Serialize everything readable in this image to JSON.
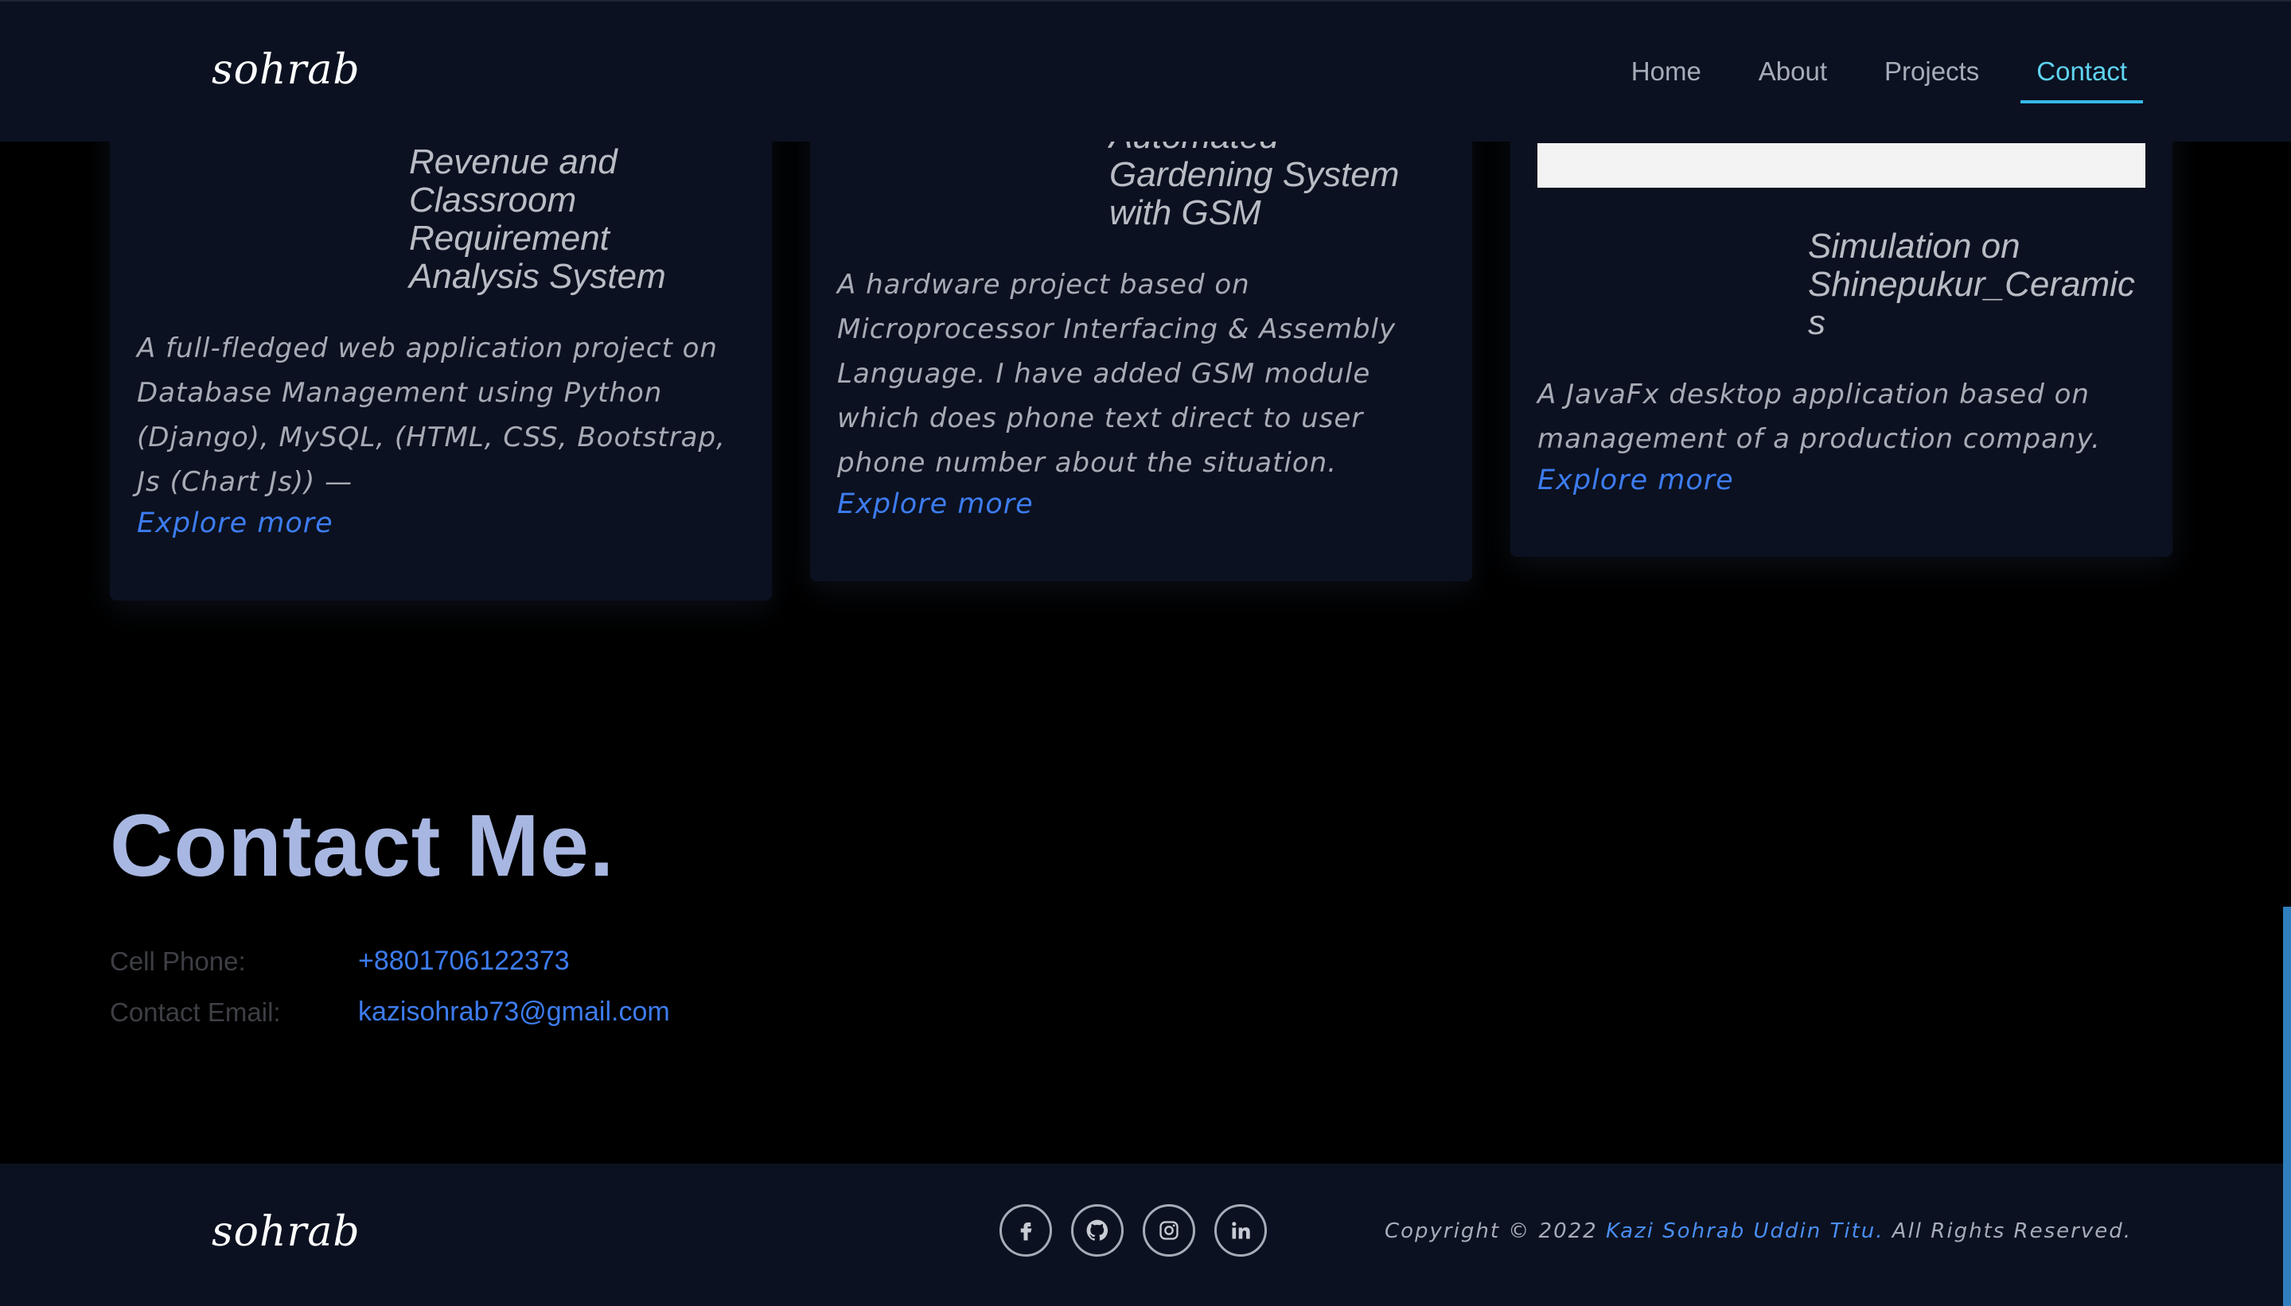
{
  "header": {
    "logo": "sohrab",
    "nav": [
      "Home",
      "About",
      "Projects",
      "Contact"
    ],
    "active_nav": "Contact"
  },
  "projects": [
    {
      "title": "Revenue and\nClassroom\nRequirement\nAnalysis System",
      "description": "A full-fledged web application project on Database Management using Python (Django), MySQL, (HTML, CSS, Bootstrap, Js (Chart Js)) —",
      "link": "Explore more"
    },
    {
      "title": "Automated\nGardening System\nwith GSM",
      "description": "A hardware project based on Microprocessor Interfacing & Assembly Language. I have added GSM module which does phone text direct to user phone number about the situation.",
      "link": "Explore more"
    },
    {
      "title": "Simulation on\nShinepukur_Ceramic\ns",
      "description": "A JavaFx desktop application based on management of a production company.",
      "link": "Explore more"
    }
  ],
  "contact": {
    "heading": "Contact Me.",
    "phone_label": "Cell Phone:",
    "phone": "+8801706122373",
    "email_label": "Contact Email:",
    "email": "kazisohrab73@gmail.com"
  },
  "footer": {
    "logo": "sohrab",
    "social": [
      "facebook-icon",
      "github-icon",
      "instagram-icon",
      "linkedin-icon"
    ],
    "copyright_prefix": "Copyright © 2022 ",
    "copyright_name": "Kazi Sohrab Uddin Titu.",
    "copyright_suffix": " All Rights Reserved."
  },
  "colors": {
    "accent": "#3d7cf0",
    "nav_active": "#5fd3f0",
    "panel": "#0b1120",
    "heading": "#a8b7e2"
  }
}
